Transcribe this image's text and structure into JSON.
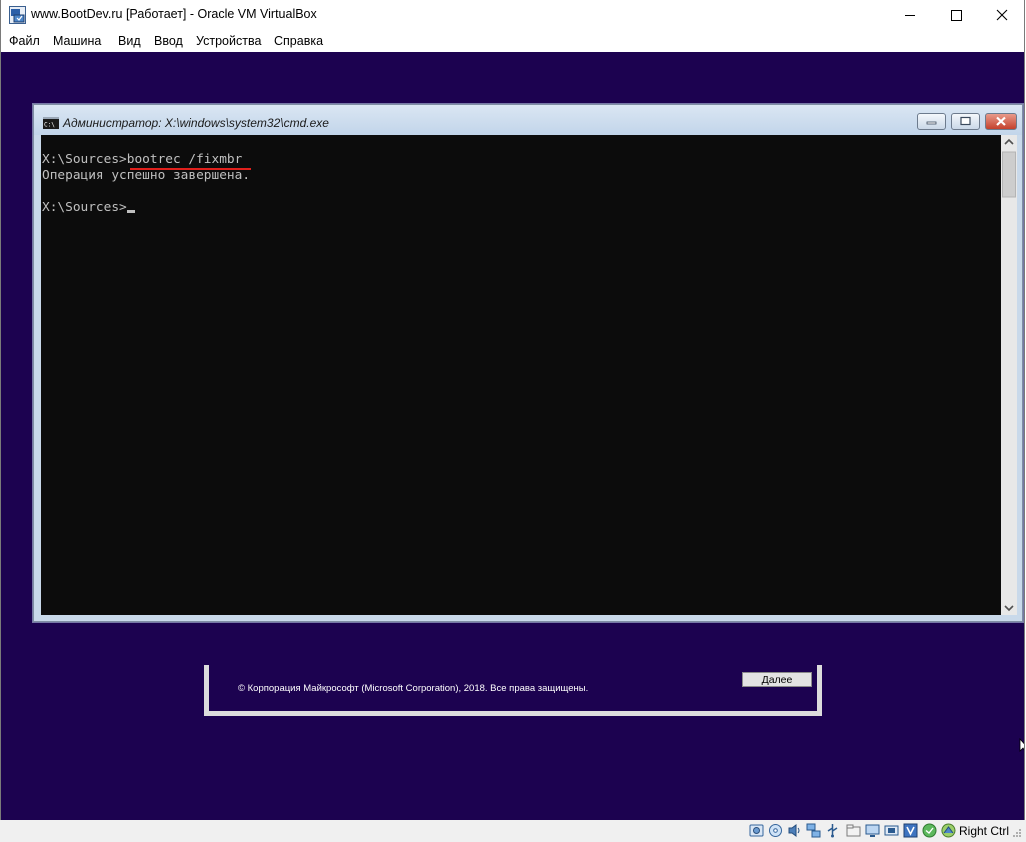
{
  "window": {
    "title": "www.BootDev.ru [Работает] - Oracle VM VirtualBox",
    "controls": [
      "minimize-icon",
      "maximize-icon",
      "close-icon"
    ]
  },
  "menu": {
    "items": [
      "Файл",
      "Машина",
      "Вид",
      "Ввод",
      "Устройства",
      "Справка"
    ]
  },
  "cmd": {
    "title": "Администратор: X:\\windows\\system32\\cmd.exe",
    "prompt1": "X:\\Sources>",
    "command": "bootrec /fixmbr",
    "output": "Операция успешно завершена.",
    "prompt2": "X:\\Sources>",
    "colors": {
      "console_bg": "#0c0c0c",
      "console_text": "#c0c0c0",
      "underline": "#e0201c"
    }
  },
  "setup": {
    "copyright": "© Корпорация Майкрософт (Microsoft Corporation), 2018. Все права защищены.",
    "next_button": "Далее"
  },
  "statusbar": {
    "icons": [
      "hard-disk-icon",
      "optical-drive-icon",
      "audio-icon",
      "network-icon",
      "usb-icon",
      "shared-folders-icon",
      "display-icon",
      "video-capture-icon",
      "virtualization-icon",
      "mouse-integration-icon",
      "keyboard-icon"
    ],
    "host_key": "Right Ctrl"
  },
  "colors": {
    "vm_background": "#1c0250"
  }
}
